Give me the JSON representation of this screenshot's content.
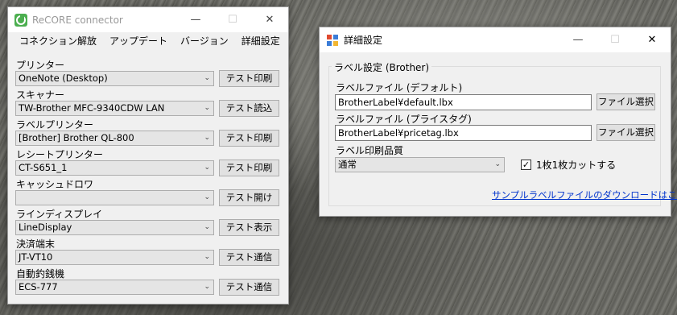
{
  "main_window": {
    "title": "ReCORE connector",
    "menu": [
      "コネクション解放",
      "アップデート",
      "バージョン",
      "詳細設定"
    ],
    "devices": [
      {
        "label": "プリンター",
        "value": "OneNote (Desktop)",
        "button": "テスト印刷"
      },
      {
        "label": "スキャナー",
        "value": "TW-Brother MFC-9340CDW LAN",
        "button": "テスト読込"
      },
      {
        "label": "ラベルプリンター",
        "value": "[Brother] Brother QL-800",
        "button": "テスト印刷"
      },
      {
        "label": "レシートプリンター",
        "value": "CT-S651_1",
        "button": "テスト印刷"
      },
      {
        "label": "キャッシュドロワ",
        "value": "",
        "button": "テスト開け"
      },
      {
        "label": "ラインディスプレイ",
        "value": "LineDisplay",
        "button": "テスト表示"
      },
      {
        "label": "決済端末",
        "value": "JT-VT10",
        "button": "テスト通信"
      },
      {
        "label": "自動釣銭機",
        "value": "ECS-777",
        "button": "テスト通信"
      }
    ]
  },
  "settings_window": {
    "title": "詳細設定",
    "group_title": "ラベル設定 (Brother)",
    "default_file_label": "ラベルファイル (デフォルト)",
    "default_file_value": "BrotherLabel¥default.lbx",
    "price_file_label": "ラベルファイル (プライスタグ)",
    "price_file_value": "BrotherLabel¥pricetag.lbx",
    "file_select_button": "ファイル選択",
    "quality_label": "ラベル印刷品質",
    "quality_value": "通常",
    "cut_checkbox_label": "1枚1枚カットする",
    "cut_checked": true,
    "download_link": "サンプルラベルファイルのダウンロードはこちら"
  },
  "icons": {
    "minimize": "—",
    "maximize": "☐",
    "close": "✕",
    "dropdown": "⌄",
    "check": "✓"
  }
}
